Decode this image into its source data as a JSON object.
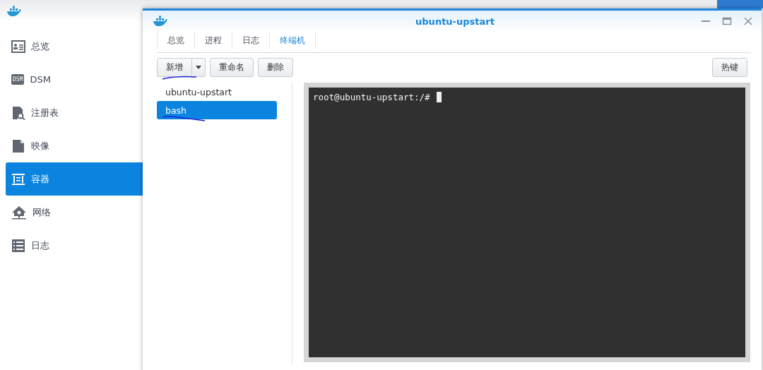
{
  "sidebar": {
    "items": [
      {
        "label": "总览",
        "kind": "card",
        "selected": false
      },
      {
        "label": "DSM",
        "kind": "badge",
        "badge_text": "DSM",
        "selected": false
      },
      {
        "label": "注册表",
        "kind": "search-doc",
        "selected": false
      },
      {
        "label": "映像",
        "kind": "doc",
        "selected": false
      },
      {
        "label": "容器",
        "kind": "container",
        "selected": true
      },
      {
        "label": "网络",
        "kind": "network",
        "selected": false
      },
      {
        "label": "日志",
        "kind": "list",
        "selected": false
      }
    ]
  },
  "window": {
    "title": "ubuntu-upstart",
    "tabs": [
      {
        "label": "总览",
        "selected": false
      },
      {
        "label": "进程",
        "selected": false
      },
      {
        "label": "日志",
        "selected": false
      },
      {
        "label": "终端机",
        "selected": true
      }
    ],
    "toolbar": {
      "add_button": {
        "label": "新增",
        "underlined": true
      },
      "buttons": [
        "重命名",
        "删除"
      ],
      "hotkey_button": "热键"
    },
    "sessions": [
      {
        "label": "ubuntu-upstart",
        "selected": false,
        "underlined": false
      },
      {
        "label": "bash",
        "selected": true,
        "underlined": true
      }
    ],
    "terminal": {
      "prompt": "root@ubuntu-upstart:/#"
    }
  }
}
